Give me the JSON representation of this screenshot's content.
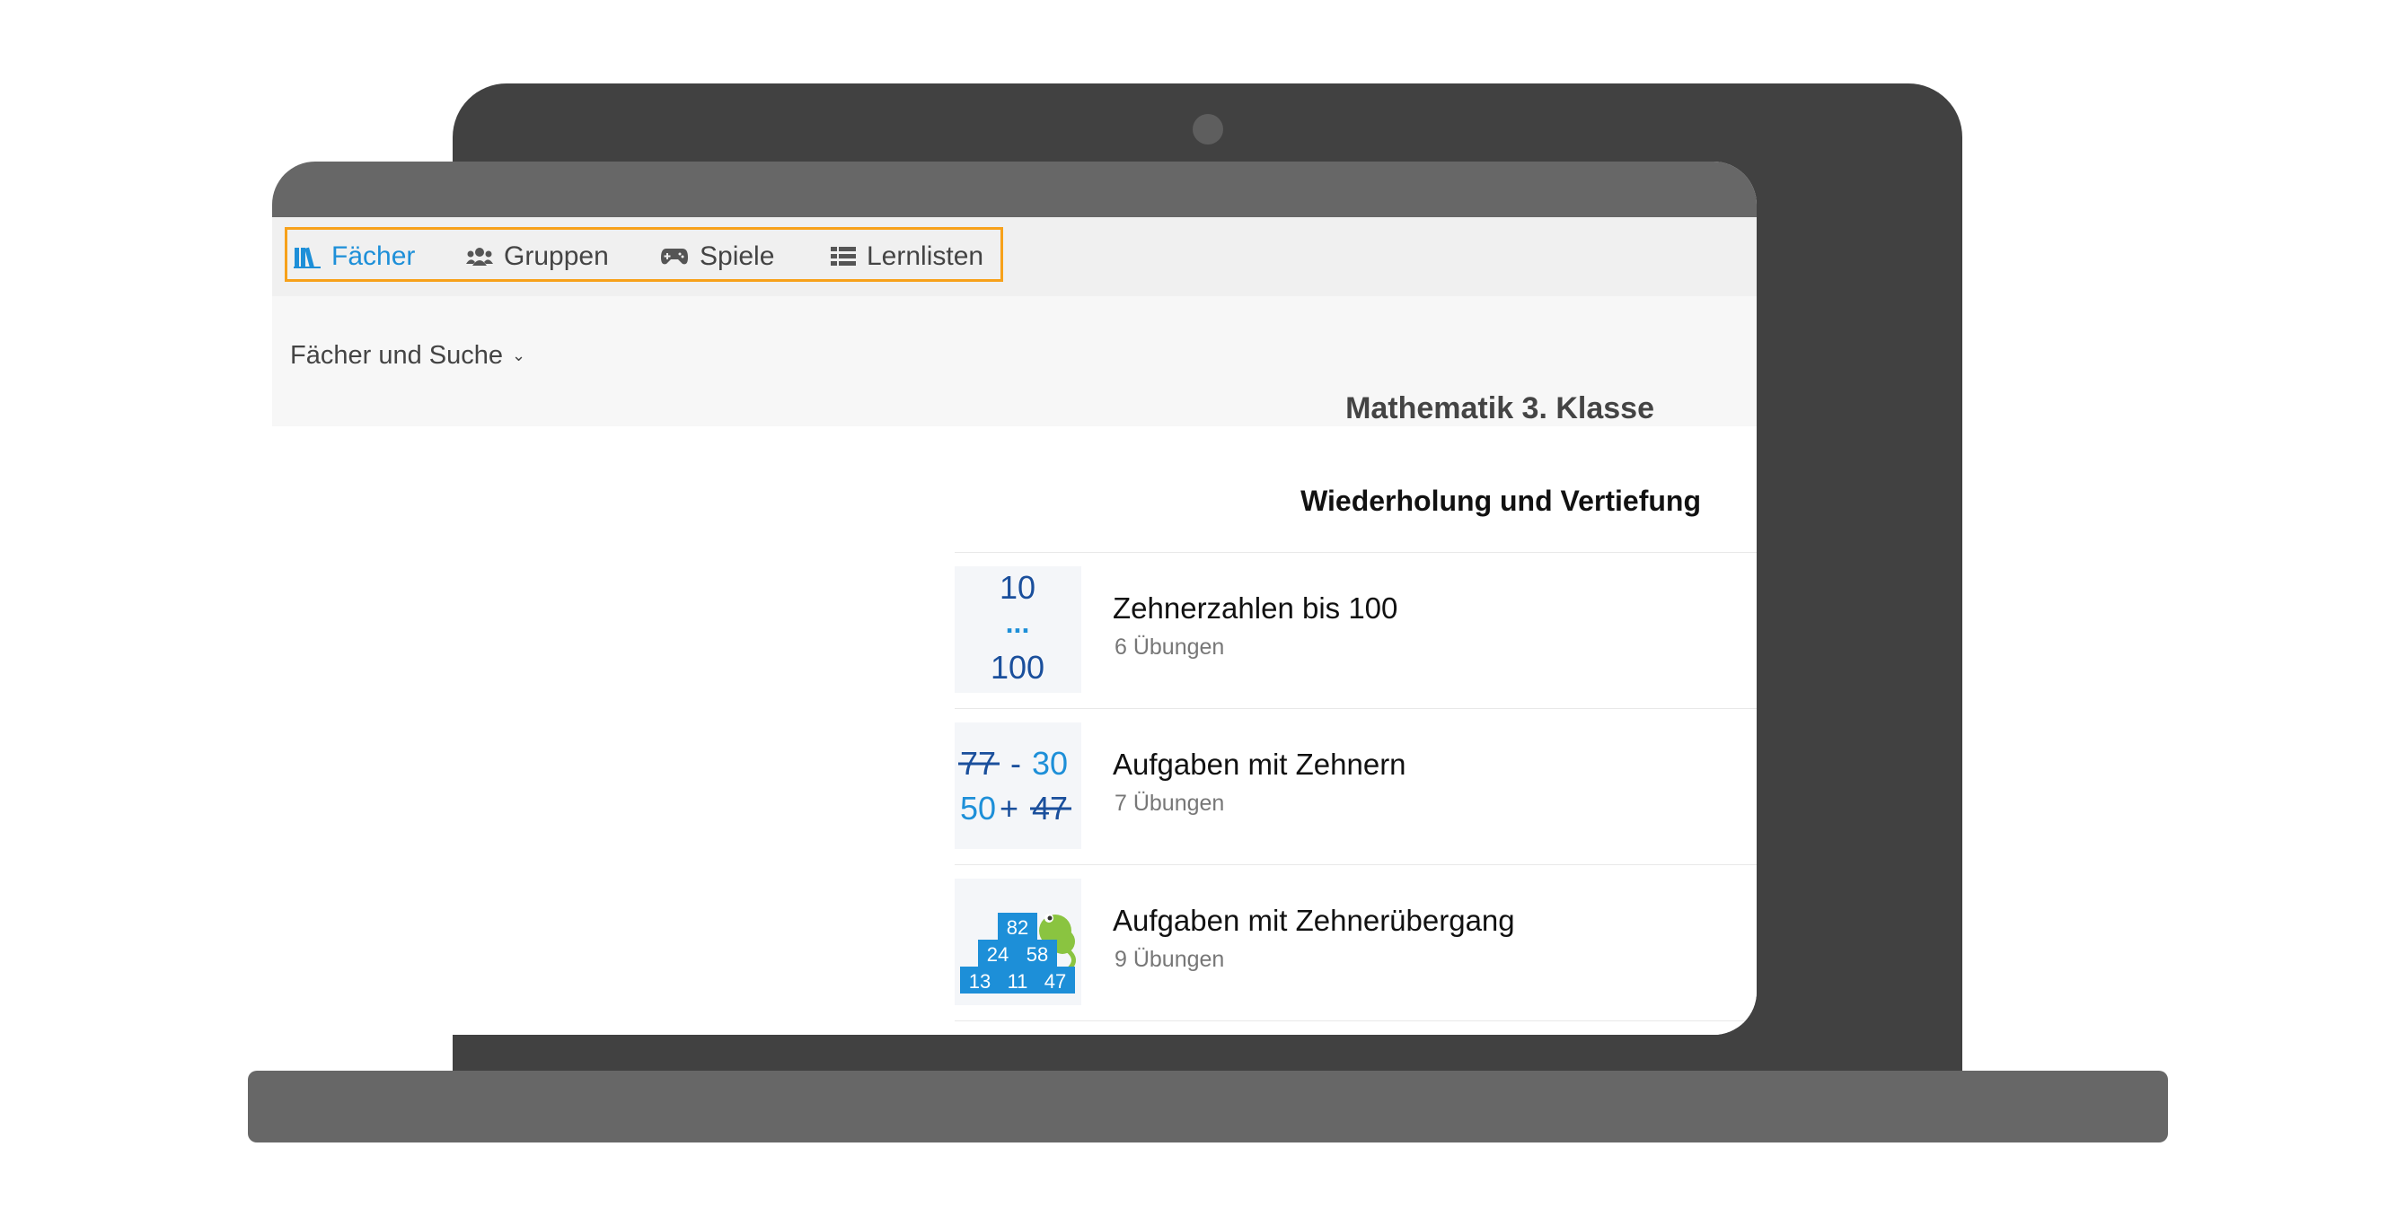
{
  "nav": {
    "items": [
      {
        "label": "Fächer",
        "icon": "books-icon",
        "active": true
      },
      {
        "label": "Gruppen",
        "icon": "users-icon",
        "active": false
      },
      {
        "label": "Spiele",
        "icon": "gamepad-icon",
        "active": false
      },
      {
        "label": "Lernlisten",
        "icon": "list-icon",
        "active": false
      }
    ]
  },
  "breadcrumb": {
    "label": "Fächer und Suche"
  },
  "page": {
    "title": "Mathematik 3. Klasse"
  },
  "section": {
    "title": "Wiederholung und Vertiefung"
  },
  "items": [
    {
      "title": "Zehnerzahlen bis 100",
      "subtitle": "6 Übungen",
      "thumb": {
        "top": "10",
        "middle": "...",
        "bottom": "100"
      }
    },
    {
      "title": "Aufgaben mit Zehnern",
      "subtitle": "7 Übungen",
      "thumb": {
        "a": "77",
        "op1": "-",
        "b": "30",
        "c": "50",
        "op2": "+",
        "d": "47"
      }
    },
    {
      "title": "Aufgaben mit Zehnerübergang",
      "subtitle": "9 Übungen",
      "thumb": {
        "top": "82",
        "mid_left": "24",
        "mid_right": "58",
        "bot_left": "13",
        "bot_mid": "11",
        "bot_right": "47"
      }
    }
  ],
  "colors": {
    "accent": "#1d8fd8",
    "highlight": "#f7a11a",
    "dark_blue": "#1a4f9c"
  }
}
